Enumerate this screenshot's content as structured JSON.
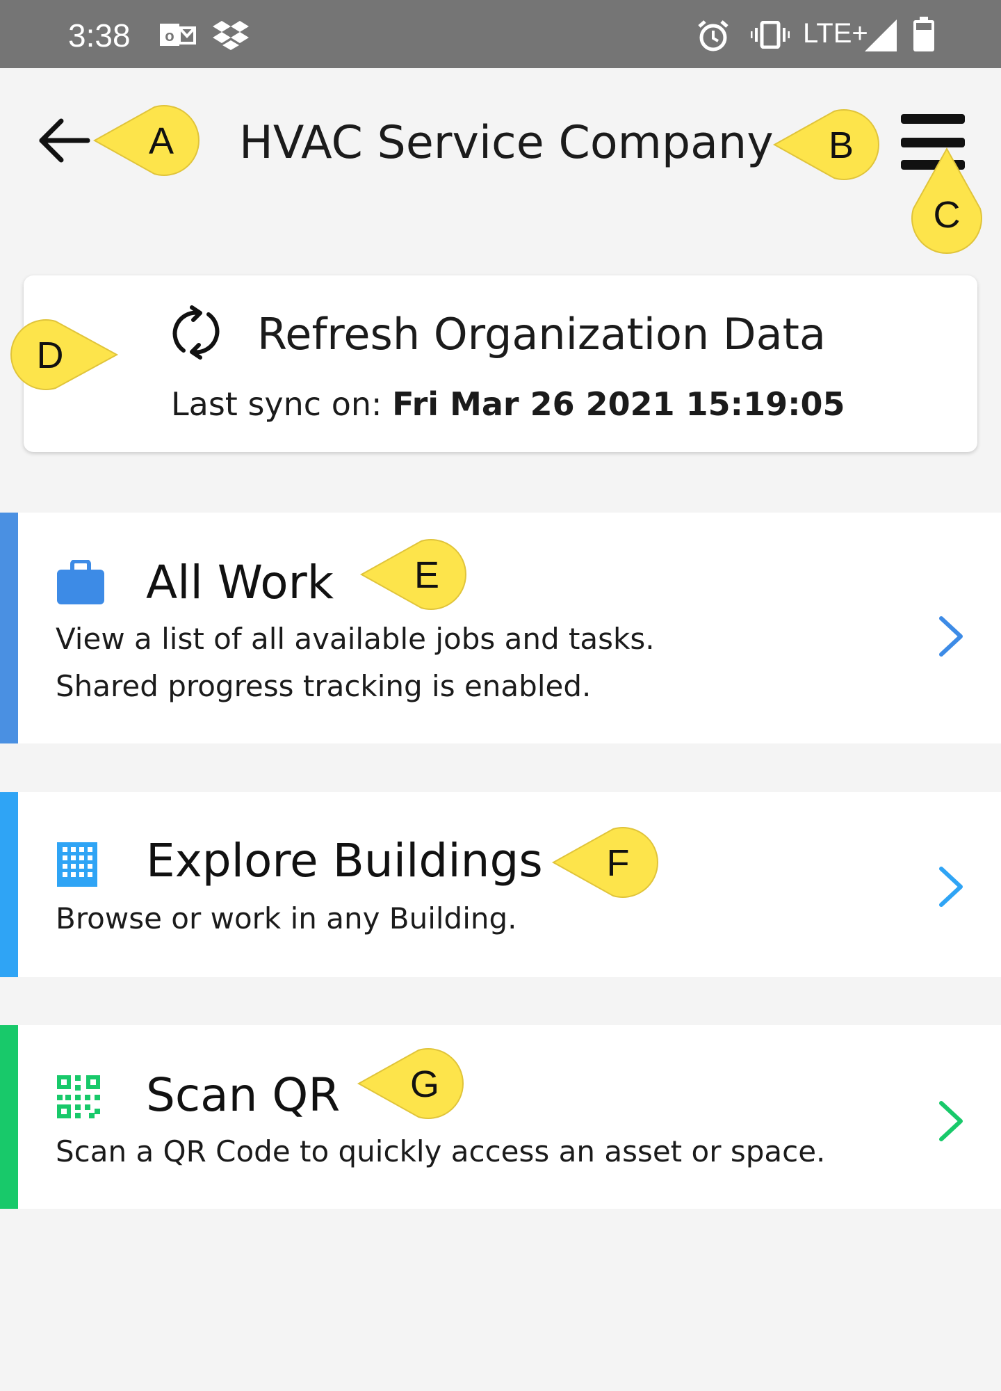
{
  "status_bar": {
    "time": "3:38",
    "network": "LTE+",
    "icons": [
      "outlook-icon",
      "dropbox-icon",
      "alarm-icon",
      "vibrate-icon",
      "signal-icon",
      "battery-icon"
    ]
  },
  "header": {
    "title": "HVAC Service Company",
    "back_icon": "arrow-left-icon",
    "menu_icon": "hamburger-menu-icon"
  },
  "refresh_card": {
    "title": "Refresh Organization Data",
    "sync_label": "Last sync on:",
    "sync_value": "Fri Mar 26 2021 15:19:05",
    "icon": "refresh-icon"
  },
  "menu": [
    {
      "title": "All Work",
      "desc_lines": [
        "View a list of all available jobs and tasks.",
        "Shared progress tracking is enabled."
      ],
      "icon": "briefcase-icon",
      "accent": "#4a90e2"
    },
    {
      "title": "Explore Buildings",
      "desc_lines": [
        "Browse or work in any Building."
      ],
      "icon": "building-icon",
      "accent": "#2fa4f5"
    },
    {
      "title": "Scan QR",
      "desc_lines": [
        "Scan a QR Code to quickly access an asset or space."
      ],
      "icon": "qr-code-icon",
      "accent": "#18c96a"
    }
  ],
  "callouts": [
    "A",
    "B",
    "C",
    "D",
    "E",
    "F",
    "G"
  ],
  "colors": {
    "callout": "#fde44b",
    "status_bar": "#757575",
    "background": "#f4f4f4"
  }
}
